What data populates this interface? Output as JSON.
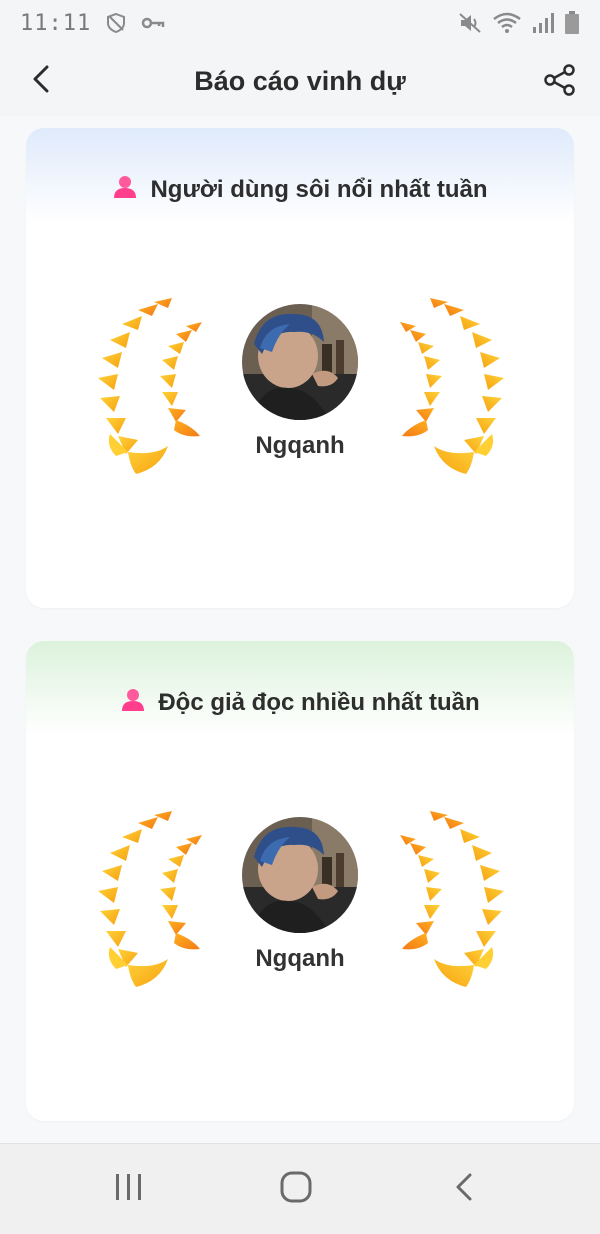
{
  "status_bar": {
    "time": "11:11",
    "icons": [
      "shield-off-icon",
      "vpn-key-icon",
      "mute-icon",
      "wifi-icon",
      "cell-signal-icon",
      "battery-icon"
    ]
  },
  "header": {
    "title": "Báo cáo vinh dự",
    "back_icon": "chevron-left-icon",
    "share_icon": "share-icon"
  },
  "cards": [
    {
      "title": "Người dùng sôi nổi nhất tuần",
      "title_icon": "user-icon",
      "user_name": "Ngqanh",
      "header_tint": "#dfeafb"
    },
    {
      "title": "Độc giả đọc nhiều nhất tuần",
      "title_icon": "user-icon",
      "user_name": "Ngqanh",
      "header_tint": "#dcf2dc"
    }
  ],
  "colors": {
    "laurel_gold": "#ffc21a",
    "laurel_orange": "#f5821f",
    "user_icon_pink": "#ff3f8e"
  },
  "nav_bar": {
    "items": [
      "recent-apps-icon",
      "home-icon",
      "back-icon"
    ]
  }
}
